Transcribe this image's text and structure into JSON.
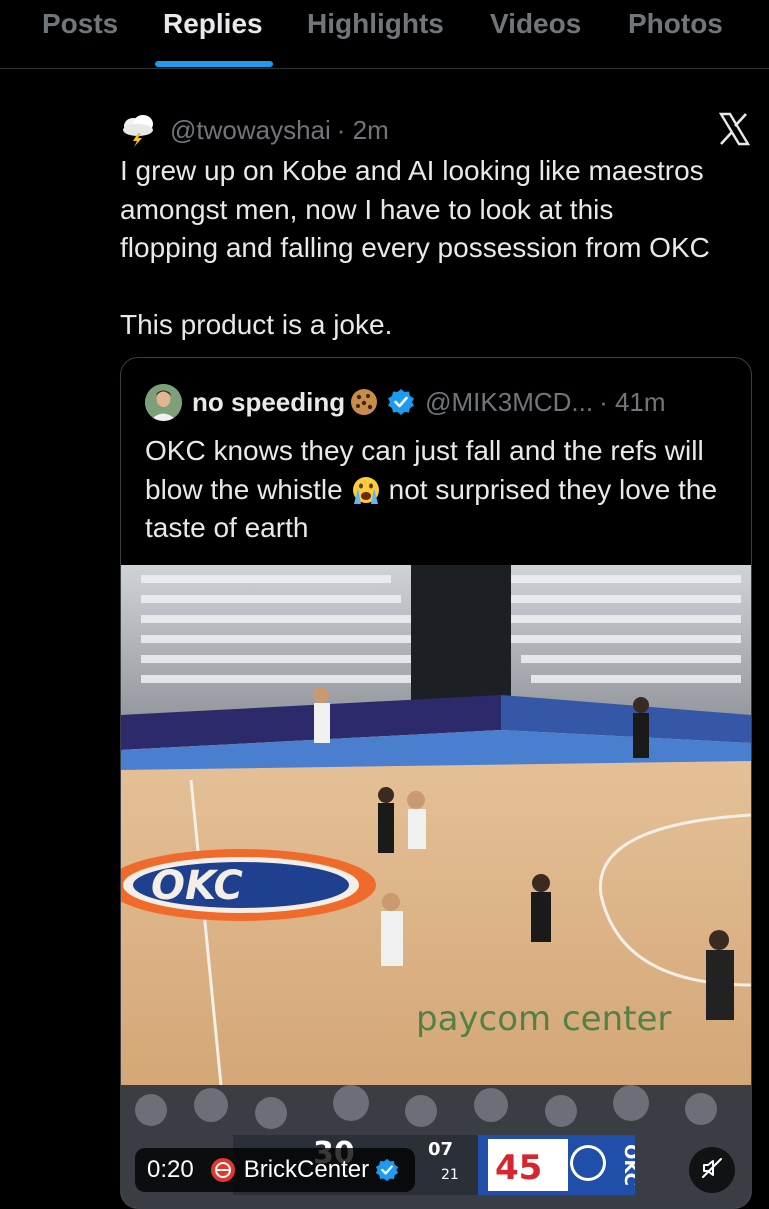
{
  "tabs": [
    {
      "label": "Posts",
      "active": false
    },
    {
      "label": "Replies",
      "active": true
    },
    {
      "label": "Highlights",
      "active": false
    },
    {
      "label": "Videos",
      "active": false
    },
    {
      "label": "Photos",
      "active": false
    }
  ],
  "tweet": {
    "handle": "@twowayshai",
    "time": "· 2m",
    "icon": "storm-cloud-emoji",
    "text_lines": [
      "I grew up on Kobe and AI looking like maestros",
      "amongst men, now I have to look at this",
      "flopping and falling every possession from OKC"
    ],
    "text_last": "This product is a joke.",
    "source_icon": "x-logo-icon"
  },
  "quote": {
    "name": "no speeding",
    "handle": "@MIK3MCD...",
    "time": "· 41m",
    "text_part1": "OKC knows they can just fall and the refs will blow the whistle",
    "text_part2": "not surprised they love the taste of earth",
    "video": {
      "duration": "0:20",
      "channel": "BrickCenter",
      "scoreboard": {
        "away_score": "30",
        "clock": "07",
        "shot_clock": "21",
        "home_score": "45",
        "home_team": "OKC"
      },
      "court_logo": "OKC",
      "sponsor": "paycom center"
    }
  },
  "colors": {
    "background": "#000000",
    "text": "#e7e9ea",
    "muted": "#71767b",
    "accent": "#1d9bf0",
    "border": "#2f3336"
  }
}
